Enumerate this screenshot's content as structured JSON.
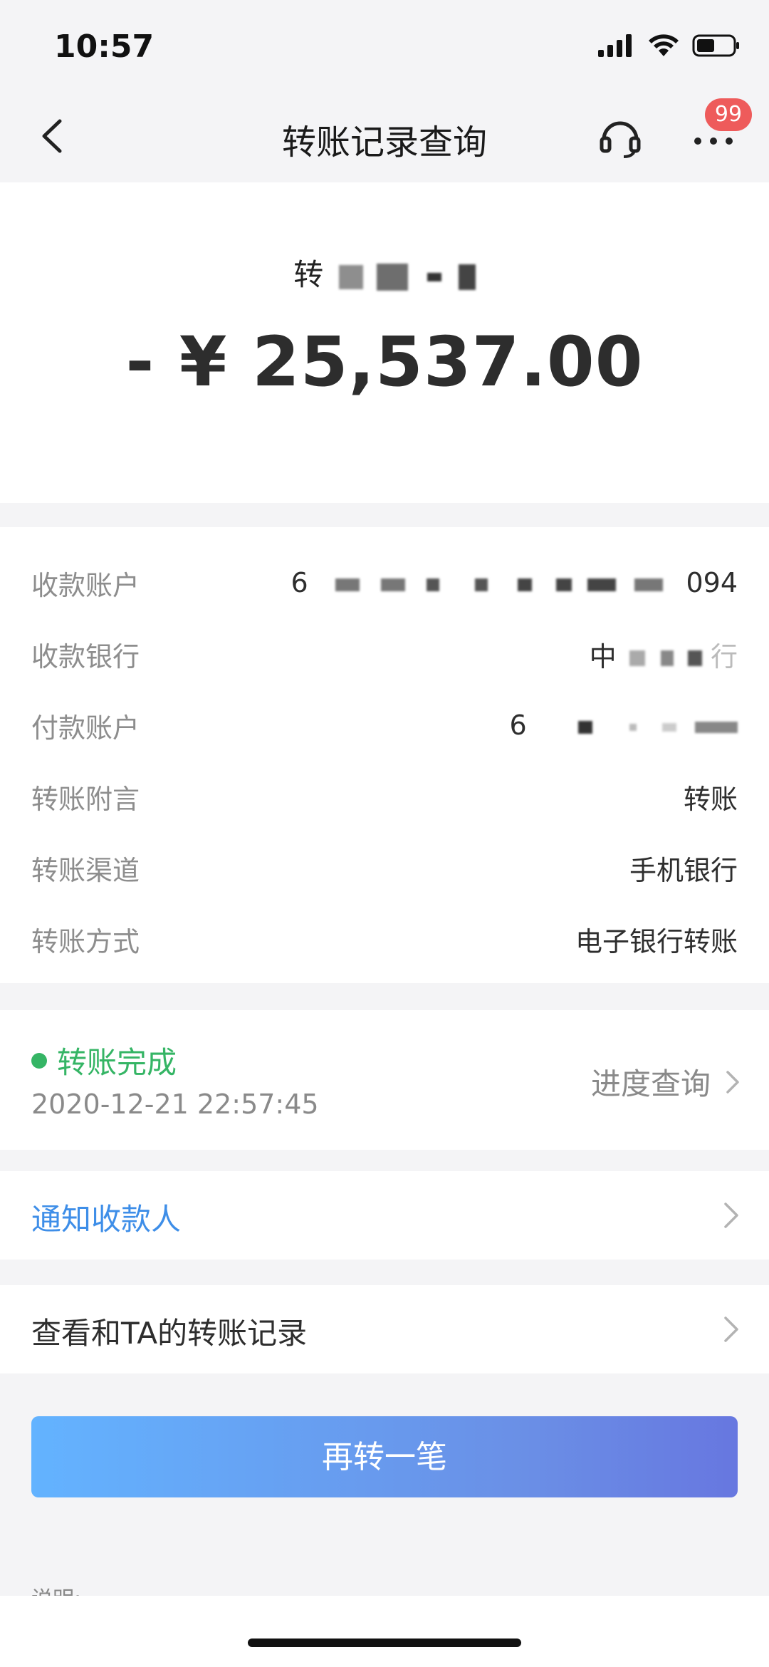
{
  "status_bar": {
    "time": "10:57"
  },
  "nav": {
    "title": "转账记录查询",
    "badge_count": "99"
  },
  "summary": {
    "payee_name": "转",
    "amount": "- ¥ 25,537.00"
  },
  "details": [
    {
      "label": "收款账户",
      "value_prefix": "6",
      "value_suffix": "094"
    },
    {
      "label": "收款银行",
      "value_prefix": "中",
      "value_suffix": "行"
    },
    {
      "label": "付款账户",
      "value_prefix": "6",
      "value_suffix": ""
    },
    {
      "label": "转账附言",
      "value": "转账"
    },
    {
      "label": "转账渠道",
      "value": "手机银行"
    },
    {
      "label": "转账方式",
      "value": "电子银行转账"
    }
  ],
  "transfer_status": {
    "status": "转账完成",
    "timestamp": "2020-12-21 22:57:45",
    "progress_link": "进度查询"
  },
  "actions": {
    "notify_payee": "通知收款人",
    "view_records": "查看和TA的转账记录",
    "transfer_again": "再转一笔"
  },
  "note": {
    "label": "说明:"
  },
  "colors": {
    "success_green": "#35b565",
    "link_blue": "#3e8ee8",
    "badge_red": "#ee5b5b",
    "button_gradient_start": "#63b3ff",
    "button_gradient_end": "#6777e0"
  },
  "icons": [
    "back-chevron-icon",
    "headset-icon",
    "more-dots-icon",
    "signal-icon",
    "wifi-icon",
    "battery-icon",
    "chevron-right-icon"
  ]
}
